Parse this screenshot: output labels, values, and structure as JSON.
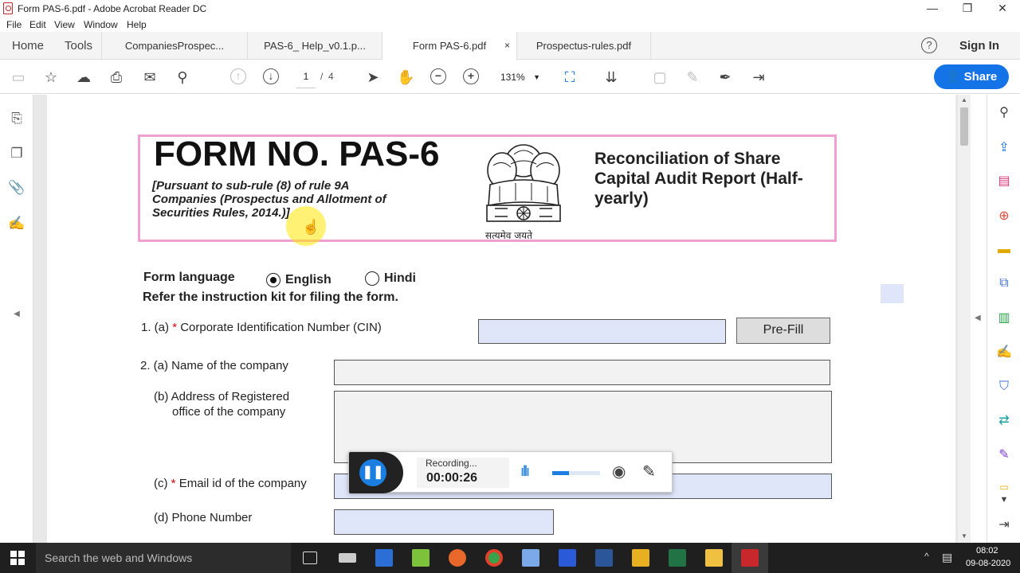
{
  "window": {
    "title": "Form PAS-6.pdf - Adobe Acrobat Reader DC"
  },
  "menu": [
    "File",
    "Edit",
    "View",
    "Window",
    "Help"
  ],
  "tabs": {
    "home": "Home",
    "tools": "Tools",
    "docs": [
      "CompaniesProspec...",
      "PAS-6_ Help_v0.1.p...",
      "Form PAS-6.pdf",
      "Prospectus-rules.pdf"
    ],
    "close": "×",
    "help": "?",
    "signin": "Sign In"
  },
  "toolbar": {
    "page_current": "1",
    "page_sep": "/",
    "page_total": "4",
    "zoom": "131%",
    "share": "Share"
  },
  "form": {
    "title": "FORM NO. PAS-6",
    "pursuant": "[Pursuant to sub-rule (8) of rule 9A Companies (Prospectus and Allotment of Securities Rules, 2014.)]",
    "motto": "सत्यमेव जयते",
    "report_title": "Reconciliation of Share Capital Audit Report (Half-yearly)",
    "lang_label": "Form language",
    "lang_english": "English",
    "lang_hindi": "Hindi",
    "instruction": "Refer the instruction kit for filing the form.",
    "q1_prefix": "1. (a)",
    "star": "*",
    "q1_label": "Corporate Identification Number (CIN)",
    "prefill": "Pre-Fill",
    "q2a": "2. (a) Name of the company",
    "q2b_line1": "(b) Address of Registered",
    "q2b_line2": "office of the company",
    "q2c_prefix": "(c)",
    "q2c_label": "Email id of the company",
    "q2d": "(d) Phone Number"
  },
  "recorder": {
    "status": "Recording...",
    "time": "00:00:26",
    "level": 0.35
  },
  "taskbar": {
    "search": "Search the web and Windows",
    "time": "08:02",
    "date": "09-08-2020"
  },
  "colors": {
    "accent": "#1473e6",
    "header_border": "#f0a0d0",
    "field_blue": "#e0e6fa"
  }
}
